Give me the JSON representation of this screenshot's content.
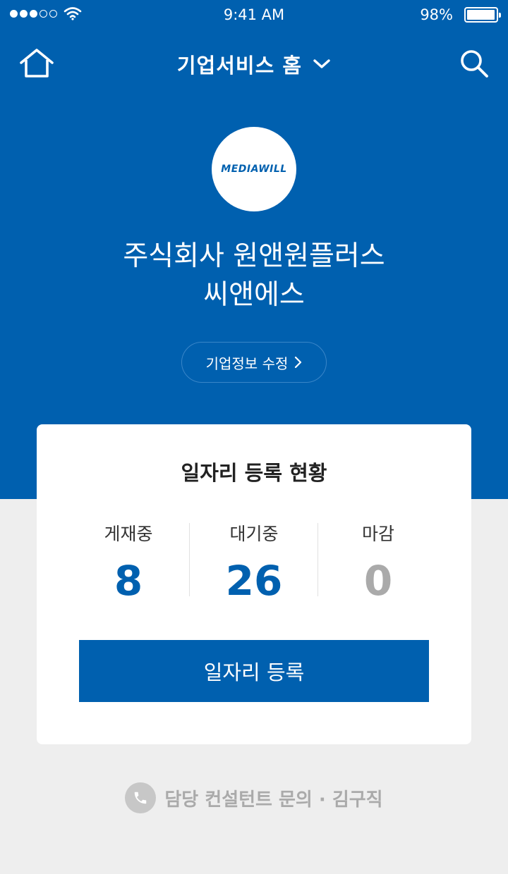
{
  "status_bar": {
    "time": "9:41 AM",
    "battery_pct": "98%",
    "battery_level": 0.98,
    "signal_bars": 3,
    "signal_total": 5
  },
  "nav": {
    "title": "기업서비스 홈",
    "home_icon": "home-icon",
    "search_icon": "search-icon",
    "dropdown_icon": "chevron-down-icon"
  },
  "company": {
    "logo_text": "MEDIAWILL",
    "name_line1": "주식회사 원앤원플러스",
    "name_line2": "씨앤에스",
    "edit_label": "기업정보 수정"
  },
  "jobs_card": {
    "title": "일자리 등록 현황",
    "stats": [
      {
        "label": "게재중",
        "value": "8",
        "color": "#0060af"
      },
      {
        "label": "대기중",
        "value": "26",
        "color": "#0060af"
      },
      {
        "label": "마감",
        "value": "0",
        "color": "#aaaaaa"
      }
    ],
    "register_label": "일자리 등록"
  },
  "contact": {
    "text": "담당 컨설턴트 문의 · 김구직",
    "icon": "phone-icon"
  },
  "colors": {
    "primary": "#0060af",
    "background": "#eeeeee",
    "muted": "#aaaaaa"
  }
}
